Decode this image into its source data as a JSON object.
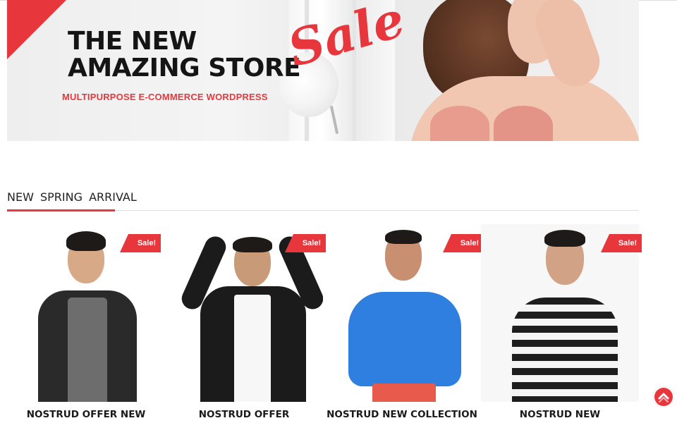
{
  "banner": {
    "headline_line1": "THE NEW",
    "headline_line2": "AMAZING STORE",
    "subtitle": "MULTIPURPOSE E-COMMERCE WORDPRESS",
    "sale_script": "Sale"
  },
  "section": {
    "title": "NEW SPRING ARRIVAL"
  },
  "products": [
    {
      "name": "NOSTRUD OFFER NEW",
      "badge": "Sale!"
    },
    {
      "name": "NOSTRUD OFFER",
      "badge": "Sale!"
    },
    {
      "name": "NOSTRUD NEW COLLECTION",
      "badge": "Sale!"
    },
    {
      "name": "NOSTRUD NEW",
      "badge": "Sale!"
    }
  ],
  "icons": {
    "scroll_top": "chevron-up-icon"
  },
  "colors": {
    "accent": "#e8363d",
    "heading": "#151515"
  }
}
